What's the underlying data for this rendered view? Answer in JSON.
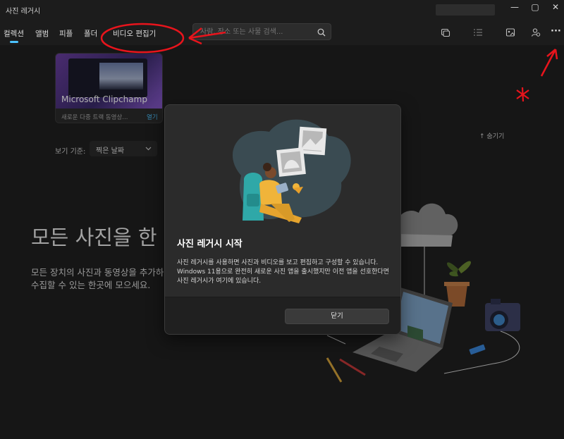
{
  "window": {
    "title": "사진 레거시",
    "controls": {
      "minimize": "—",
      "maximize": "▢",
      "close": "✕"
    }
  },
  "nav": {
    "tabs": [
      {
        "label": "컬렉션",
        "active": true
      },
      {
        "label": "앨범"
      },
      {
        "label": "피플"
      },
      {
        "label": "폴더"
      },
      {
        "label": "비디오 편집기"
      }
    ]
  },
  "search": {
    "placeholder": "사람, 장소 또는 사물 검색..."
  },
  "toolbar": {
    "more_label": "···",
    "icons": [
      "import-icon",
      "select-icon",
      "slideshow-icon",
      "account-icon",
      "more-icon"
    ]
  },
  "promo": {
    "title": "Microsoft Clipchamp",
    "description": "새로운 다중 트랙 동영상...",
    "link": "열기"
  },
  "hide": {
    "label": "숨기기"
  },
  "sort": {
    "label": "보기 기준:",
    "value": "찍은 날짜"
  },
  "hero": {
    "title": "모든 사진을 한",
    "subtitle": "모든 장치의 사진과 동영상을 추가하여 수집할 수 있는 한곳에 모으세요."
  },
  "dialog": {
    "title": "사진 레거시 시작",
    "body": "사진 레거시를 사용하면 사진과 비디오를 보고 편집하고 구성할 수 있습니다. Windows 11용으로 완전히 새로운 사진 앱을 출시했지만 이전 앱을 선호한다면 사진 레거시가 여기에 있습니다.",
    "close_label": "닫기"
  },
  "colors": {
    "accent": "#4cc2ff",
    "annotation": "#e8141c",
    "background": "#202020"
  }
}
